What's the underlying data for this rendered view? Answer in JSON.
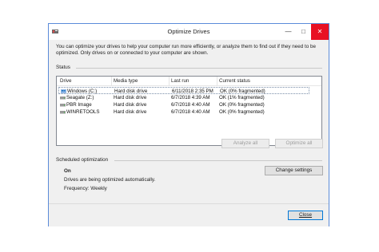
{
  "window": {
    "title": "Optimize Drives",
    "minimize_glyph": "—",
    "maximize_glyph": "□",
    "close_glyph": "✕"
  },
  "description": "You can optimize your drives to help your computer run more efficiently, or analyze them to find out if they need to be optimized. Only drives on or connected to your computer are shown.",
  "status": {
    "label": "Status",
    "columns": [
      "Drive",
      "Media type",
      "Last run",
      "Current status"
    ],
    "rows": [
      {
        "drive": "Windows (C:)",
        "media": "Hard disk drive",
        "last_run": "6/11/2018 2:35 PM",
        "status": "OK (0% fragmented)",
        "icon": "windows-drive-icon",
        "selected": true
      },
      {
        "drive": "Seagate (Z:)",
        "media": "Hard disk drive",
        "last_run": "6/7/2018 4:39 AM",
        "status": "OK (1% fragmented)",
        "icon": "hard-drive-icon",
        "selected": false
      },
      {
        "drive": "PBR Image",
        "media": "Hard disk drive",
        "last_run": "6/7/2018 4:40 AM",
        "status": "OK (0% fragmented)",
        "icon": "hard-drive-icon",
        "selected": false
      },
      {
        "drive": "WINRETOOLS",
        "media": "Hard disk drive",
        "last_run": "6/7/2018 4:40 AM",
        "status": "OK (0% fragmented)",
        "icon": "hard-drive-icon",
        "selected": false
      }
    ],
    "analyze_label": "Analyze all",
    "optimize_label": "Optimize all"
  },
  "scheduled": {
    "label": "Scheduled optimization",
    "state": "On",
    "message": "Drives are being optimized automatically.",
    "frequency": "Frequency: Weekly",
    "change_label": "Change settings"
  },
  "close_label": "Close",
  "colors": {
    "window_border": "#5b8bd9",
    "close_button": "#e81123",
    "selection_border": "#7a8ea8"
  }
}
